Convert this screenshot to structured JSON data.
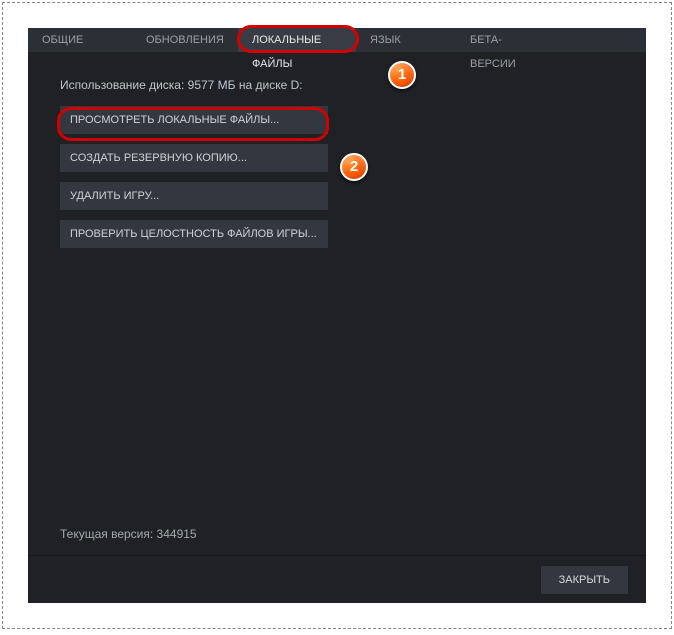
{
  "tabs": {
    "general": "ОБЩИЕ",
    "updates": "ОБНОВЛЕНИЯ",
    "local": "ЛОКАЛЬНЫЕ ФАЙЛЫ",
    "language": "ЯЗЫК",
    "beta": "БЕТА-ВЕРСИИ"
  },
  "disk_usage": "Использование диска: 9577 МБ на диске D:",
  "buttons": {
    "browse": "ПРОСМОТРЕТЬ ЛОКАЛЬНЫЕ ФАЙЛЫ...",
    "backup": "СОЗДАТЬ РЕЗЕРВНУЮ КОПИЮ...",
    "delete": "УДАЛИТЬ ИГРУ...",
    "verify": "ПРОВЕРИТЬ ЦЕЛОСТНОСТЬ ФАЙЛОВ ИГРЫ..."
  },
  "version_text": "Текущая версия: 344915",
  "footer": {
    "close": "ЗАКРЫТЬ"
  },
  "annotations": {
    "badge1": "1",
    "badge2": "2"
  }
}
